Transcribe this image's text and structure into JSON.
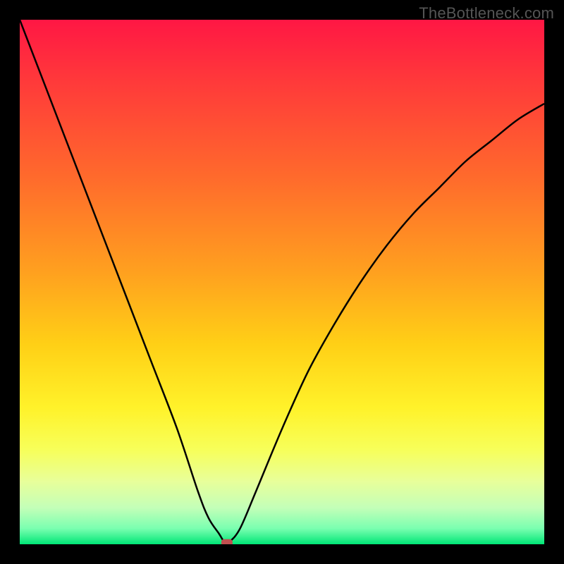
{
  "watermark": "TheBottleneck.com",
  "chart_data": {
    "type": "line",
    "title": "",
    "xlabel": "",
    "ylabel": "",
    "xlim": [
      0,
      100
    ],
    "ylim": [
      0,
      100
    ],
    "x": [
      0,
      5,
      10,
      15,
      20,
      25,
      30,
      34,
      36,
      38,
      39,
      40,
      42,
      45,
      50,
      55,
      60,
      65,
      70,
      75,
      80,
      85,
      90,
      95,
      100
    ],
    "y": [
      100,
      87,
      74,
      61,
      48,
      35,
      22,
      10,
      5,
      2,
      0.5,
      0.5,
      3,
      10,
      22,
      33,
      42,
      50,
      57,
      63,
      68,
      73,
      77,
      81,
      84
    ],
    "marker": {
      "x": 39.5,
      "y": 0.3
    },
    "gradient_stops": [
      {
        "offset": 0.0,
        "color": "#ff1744"
      },
      {
        "offset": 0.12,
        "color": "#ff3a3a"
      },
      {
        "offset": 0.3,
        "color": "#ff6a2c"
      },
      {
        "offset": 0.48,
        "color": "#ffa01f"
      },
      {
        "offset": 0.62,
        "color": "#ffd016"
      },
      {
        "offset": 0.74,
        "color": "#fff22a"
      },
      {
        "offset": 0.82,
        "color": "#f7ff5a"
      },
      {
        "offset": 0.88,
        "color": "#e8ff9a"
      },
      {
        "offset": 0.93,
        "color": "#c4ffb8"
      },
      {
        "offset": 0.97,
        "color": "#7affb0"
      },
      {
        "offset": 1.0,
        "color": "#00e676"
      }
    ]
  }
}
